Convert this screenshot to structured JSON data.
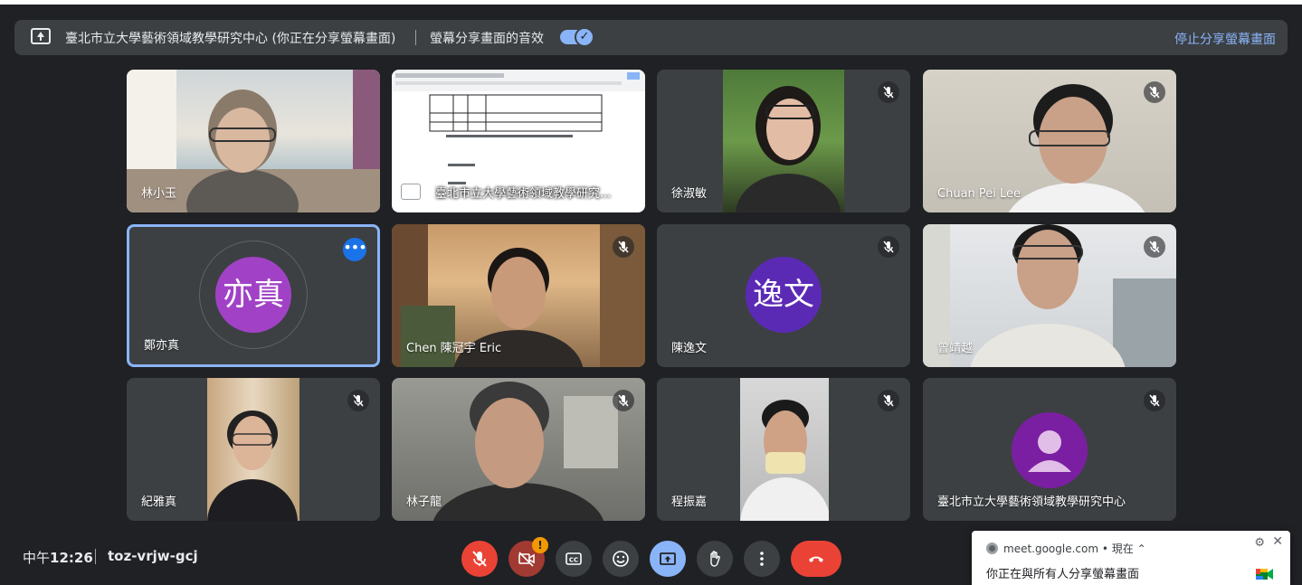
{
  "banner": {
    "presenting_text": "臺北市立大學藝術領域教學研究中心 (你正在分享螢幕畫面)",
    "audio_text": "螢幕分享畫面的音效",
    "audio_toggle_on": true,
    "stop_label": "停止分享螢幕畫面"
  },
  "tiles": [
    {
      "name": "林小玉",
      "muted": false,
      "kind": "video"
    },
    {
      "name": "臺北市立大學藝術領域教學研究...",
      "muted": false,
      "kind": "screen"
    },
    {
      "name": "徐淑敏",
      "muted": true,
      "kind": "video"
    },
    {
      "name": "Chuan Pei Lee",
      "muted": true,
      "kind": "video"
    },
    {
      "name": "鄭亦真",
      "muted": false,
      "kind": "avatar",
      "initials": "亦真",
      "active": true
    },
    {
      "name": "Chen 陳冠宇 Eric",
      "muted": true,
      "kind": "video"
    },
    {
      "name": "陳逸文",
      "muted": true,
      "kind": "avatar",
      "initials": "逸文"
    },
    {
      "name": "曾靖越",
      "muted": true,
      "kind": "video"
    },
    {
      "name": "紀雅真",
      "muted": true,
      "kind": "video"
    },
    {
      "name": "林子龍",
      "muted": true,
      "kind": "video"
    },
    {
      "name": "程振嘉",
      "muted": true,
      "kind": "video"
    },
    {
      "name": "臺北市立大學藝術領域教學研究中心",
      "muted": true,
      "kind": "avatar-person"
    }
  ],
  "bottom": {
    "time_prefix": "中午",
    "time": "12:26",
    "meeting_code": "toz-vrjw-gcj",
    "camera_alert_badge": "!"
  },
  "colors": {
    "background": "#202124",
    "tile": "#3c4043",
    "accent_blue": "#8ab4f8",
    "end_red": "#ea4335",
    "avatar_purple_1": "#a142c6",
    "avatar_purple_2": "#5b2ab5",
    "avatar_purple_3": "#7b1fa2"
  },
  "toast": {
    "source": "meet.google.com",
    "time": "現在",
    "message": "你正在與所有人分享螢幕畫面"
  }
}
